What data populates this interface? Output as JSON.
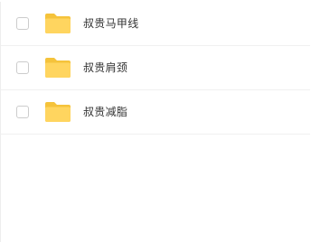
{
  "files": [
    {
      "name": "叔贵马甲线",
      "icon": "folder-icon"
    },
    {
      "name": "叔贵肩颈",
      "icon": "folder-icon"
    },
    {
      "name": "叔贵减脂",
      "icon": "folder-icon"
    }
  ],
  "colors": {
    "folder_back": "#F5C33B",
    "folder_front": "#FFD55F",
    "row_border": "#F0F0F0",
    "text": "#333333"
  }
}
